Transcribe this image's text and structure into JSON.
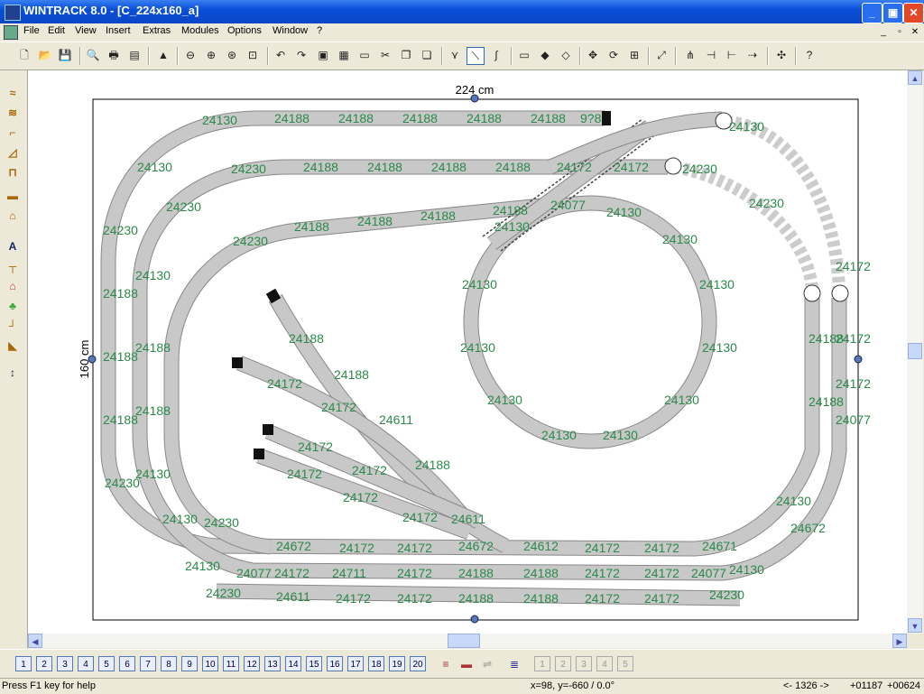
{
  "window": {
    "title": "WINTRACK 8.0 - [C_224x160_a]",
    "minimize": "_",
    "maximize": "▣",
    "close": "✕"
  },
  "menu": [
    "File",
    "Edit",
    "View",
    "Insert",
    "Extras",
    "Modules",
    "Options",
    "Window",
    "?"
  ],
  "mdi": {
    "minimize": "_",
    "restore": "▫",
    "close": "✕"
  },
  "toolbar_icons": [
    "new-icon",
    "open-icon",
    "save-icon",
    "print-preview-icon",
    "print-icon",
    "calculator-icon",
    "landscape-icon",
    "zoom-out-icon",
    "zoom-in-icon",
    "zoom-fit-icon",
    "zoom-window-icon",
    "undo-icon",
    "redo-icon",
    "copy-icon",
    "paste-icon",
    "clipboard-icon",
    "cut-icon",
    "duplicate-icon",
    "stack-icon",
    "cross-icon",
    "curve-select-icon",
    "flex-icon",
    "grid-icon",
    "join-icon",
    "split-icon",
    "move-icon",
    "rotate-icon",
    "insert-track-icon",
    "switch-icon",
    "switch-alt-icon",
    "line-icon",
    "arrow-icon",
    "snap-icon",
    "help-icon"
  ],
  "left_toolbar_icons": [
    "flex-track-icon",
    "flex-track-alt-icon",
    "bridge-icon",
    "slope-icon",
    "tunnel-icon",
    "platform-icon",
    "station-icon",
    "text-icon",
    "signal-icon",
    "house-icon",
    "tree-icon",
    "contour-icon",
    "landscape-edit-icon",
    "height-icon"
  ],
  "canvas": {
    "width_label": "224 cm",
    "height_label": "160 cm",
    "tracks": {
      "outer_top": [
        "24130",
        "24188",
        "24188",
        "24188",
        "24188",
        "24188",
        "9?8"
      ],
      "second_top": [
        "24230",
        "24188",
        "24188",
        "24188",
        "24188",
        "24172",
        "24172",
        "24230"
      ],
      "third_top": [
        "24188",
        "24188",
        "24188",
        "24188",
        "24230"
      ],
      "circle": [
        "24130",
        "24130",
        "24130",
        "24130",
        "24130",
        "24130",
        "24130",
        "24130",
        "24130",
        "24130",
        "24130",
        "24130",
        "24077"
      ],
      "outer_left": [
        "24130",
        "24230",
        "24188",
        "24188",
        "24188",
        "24230"
      ],
      "inner_left": [
        "24230",
        "24130",
        "24188",
        "24188",
        "24130",
        "24130"
      ],
      "sidings": [
        "24188",
        "24188",
        "24172",
        "24172",
        "24611",
        "24172",
        "24172",
        "24188",
        "24172",
        "24172",
        "24172",
        "24611"
      ],
      "bottom_1": [
        "24230",
        "24672",
        "24172",
        "24172",
        "24672",
        "24612",
        "24172",
        "24172",
        "24671"
      ],
      "bottom_2": [
        "24130",
        "24077",
        "24172",
        "24711",
        "24172",
        "24188",
        "24188",
        "24172",
        "24172",
        "24077",
        "24130"
      ],
      "bottom_3": [
        "24230",
        "24611",
        "24172",
        "24172",
        "24188",
        "24188",
        "24172",
        "24172",
        "24230"
      ],
      "right_side": [
        "24130",
        "24230",
        "24188",
        "24188",
        "24130",
        "24172",
        "24172",
        "24172",
        "24077",
        "24672"
      ]
    }
  },
  "layers": [
    "1",
    "2",
    "3",
    "4",
    "5",
    "6",
    "7",
    "8",
    "9",
    "10",
    "11",
    "12",
    "13",
    "14",
    "15",
    "16",
    "17",
    "18",
    "19",
    "20"
  ],
  "layer_extra_icons": [
    "layers-icon",
    "layer-up-icon",
    "layer-down-icon",
    "layer-stack-icon"
  ],
  "layer_disabled": [
    "1",
    "2",
    "3",
    "4",
    "5"
  ],
  "status": {
    "help": "Press F1 key for help",
    "coords": "x=98, y=-660 / 0.0°",
    "length": "<- 1326 ->",
    "pos1": "+01187",
    "pos2": "+00624"
  }
}
